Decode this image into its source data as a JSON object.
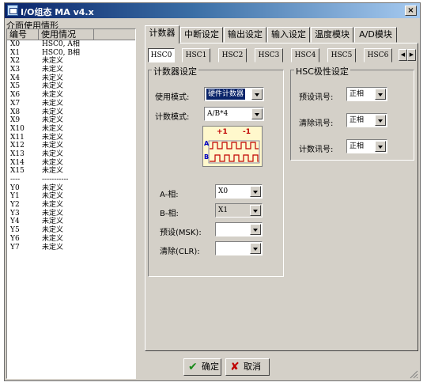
{
  "window": {
    "title": "I/O组态 MA v4.x",
    "close": "×"
  },
  "left_panel": {
    "title": "介面使用情形",
    "columns": [
      "编号",
      "使用情况"
    ],
    "rows": [
      {
        "id": "X0",
        "usage": "HSC0, A相"
      },
      {
        "id": "X1",
        "usage": "HSC0, B相"
      },
      {
        "id": "X2",
        "usage": "未定义"
      },
      {
        "id": "X3",
        "usage": "未定义"
      },
      {
        "id": "X4",
        "usage": "未定义"
      },
      {
        "id": "X5",
        "usage": "未定义"
      },
      {
        "id": "X6",
        "usage": "未定义"
      },
      {
        "id": "X7",
        "usage": "未定义"
      },
      {
        "id": "X8",
        "usage": "未定义"
      },
      {
        "id": "X9",
        "usage": "未定义"
      },
      {
        "id": "X10",
        "usage": "未定义"
      },
      {
        "id": "X11",
        "usage": "未定义"
      },
      {
        "id": "X12",
        "usage": "未定义"
      },
      {
        "id": "X13",
        "usage": "未定义"
      },
      {
        "id": "X14",
        "usage": "未定义"
      },
      {
        "id": "X15",
        "usage": "未定义"
      },
      {
        "id": "----",
        "usage": "-----------"
      },
      {
        "id": "Y0",
        "usage": "未定义"
      },
      {
        "id": "Y1",
        "usage": "未定义"
      },
      {
        "id": "Y2",
        "usage": "未定义"
      },
      {
        "id": "Y3",
        "usage": "未定义"
      },
      {
        "id": "Y4",
        "usage": "未定义"
      },
      {
        "id": "Y5",
        "usage": "未定义"
      },
      {
        "id": "Y6",
        "usage": "未定义"
      },
      {
        "id": "Y7",
        "usage": "未定义"
      }
    ]
  },
  "tabs": [
    "计数器",
    "中断设定",
    "输出设定",
    "输入设定",
    "温度模块",
    "A/D模块"
  ],
  "subtabs": [
    "HSC0",
    "HSC1",
    "HSC2",
    "HSC3",
    "HSC4",
    "HSC5",
    "HSC6"
  ],
  "counter_group": {
    "title": "计数器设定",
    "use_mode_label": "使用模式:",
    "use_mode_value": "硬件计数器",
    "count_mode_label": "计数模式:",
    "count_mode_value": "A/B*4",
    "diagram": {
      "plus": "+1",
      "minus": "-1",
      "a": "A",
      "b": "B"
    },
    "a_phase_label": "A-相:",
    "a_phase_value": "X0",
    "b_phase_label": "B-相:",
    "b_phase_value": "X1",
    "preset_label": "预设(MSK):",
    "preset_value": "",
    "clear_label": "清除(CLR):",
    "clear_value": ""
  },
  "polarity_group": {
    "title": "HSC极性设定",
    "preset_label": "预设讯号:",
    "preset_value": "正相",
    "clear_label": "清除讯号:",
    "clear_value": "正相",
    "count_label": "计数讯号:",
    "count_value": "正相"
  },
  "buttons": {
    "ok": "确定",
    "ok_icon": "✔",
    "cancel": "取消",
    "cancel_icon": "✘"
  },
  "colors": {
    "title_start": "#0a246a",
    "title_end": "#a6caf0",
    "ok_icon": "#1a8a1a",
    "cancel_icon": "#c00000"
  }
}
